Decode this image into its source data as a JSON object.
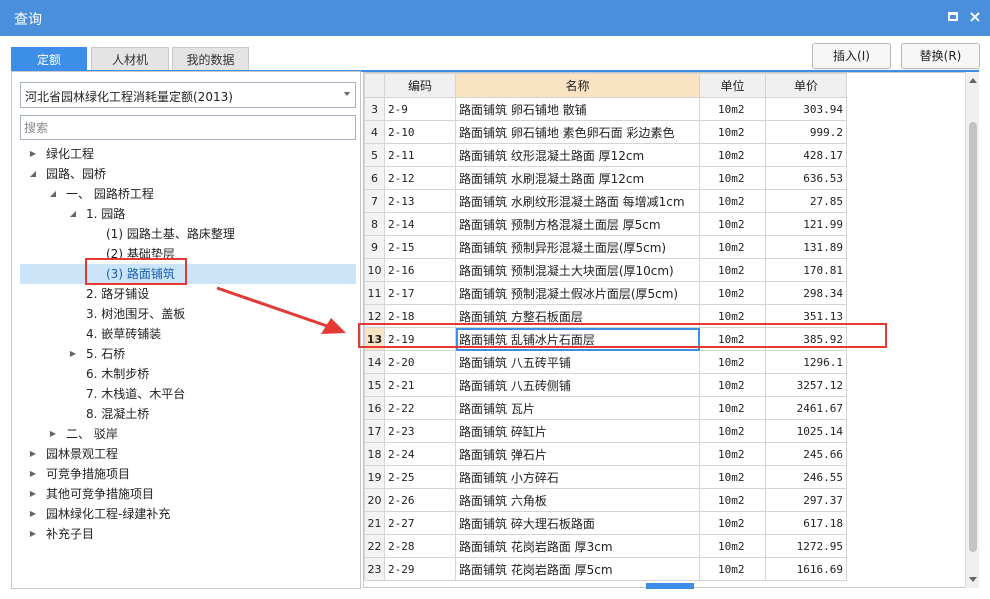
{
  "window": {
    "title": "查询",
    "maximize_icon": "maximize-icon",
    "close_label": "×"
  },
  "tabs": [
    {
      "label": "定额",
      "active": true
    },
    {
      "label": "人材机",
      "active": false
    },
    {
      "label": "我的数据",
      "active": false
    }
  ],
  "toolbar": {
    "insert_label": "插入(I)",
    "replace_label": "替换(R)"
  },
  "left": {
    "library_value": "河北省园林绿化工程消耗量定额(2013)",
    "search_placeholder": "搜索",
    "tree": [
      {
        "label": "绿化工程",
        "level": 0,
        "caret": "right"
      },
      {
        "label": "园路、园桥",
        "level": 0,
        "caret": "down"
      },
      {
        "label": "一、 园路桥工程",
        "level": 1,
        "caret": "down"
      },
      {
        "label": "1. 园路",
        "level": 2,
        "caret": "down"
      },
      {
        "label": "(1) 园路土基、路床整理",
        "level": 3,
        "caret": "none"
      },
      {
        "label": "(2) 基础垫层",
        "level": 3,
        "caret": "none"
      },
      {
        "label": "(3) 路面铺筑",
        "level": 3,
        "caret": "none",
        "selected": true
      },
      {
        "label": "2. 路牙铺设",
        "level": 2,
        "caret": "none"
      },
      {
        "label": "3. 树池围牙、盖板",
        "level": 2,
        "caret": "none"
      },
      {
        "label": "4. 嵌草砖铺装",
        "level": 2,
        "caret": "none"
      },
      {
        "label": "5. 石桥",
        "level": 2,
        "caret": "right"
      },
      {
        "label": "6. 木制步桥",
        "level": 2,
        "caret": "none"
      },
      {
        "label": "7. 木栈道、木平台",
        "level": 2,
        "caret": "none"
      },
      {
        "label": "8. 混凝土桥",
        "level": 2,
        "caret": "none"
      },
      {
        "label": "二、 驳岸",
        "level": 1,
        "caret": "right"
      },
      {
        "label": "园林景观工程",
        "level": 0,
        "caret": "right"
      },
      {
        "label": "可竞争措施项目",
        "level": 0,
        "caret": "right"
      },
      {
        "label": "其他可竞争措施项目",
        "level": 0,
        "caret": "right"
      },
      {
        "label": "园林绿化工程-绿建补充",
        "level": 0,
        "caret": "right"
      },
      {
        "label": "补充子目",
        "level": 0,
        "caret": "right"
      }
    ]
  },
  "grid": {
    "headers": {
      "code": "编码",
      "name": "名称",
      "unit": "单位",
      "price": "单价"
    },
    "current_row": "13",
    "rows": [
      {
        "no": "3",
        "code": "2-9",
        "name": "路面铺筑 卵石铺地 散铺",
        "unit": "10m2",
        "price": "303.94"
      },
      {
        "no": "4",
        "code": "2-10",
        "name": "路面铺筑 卵石铺地 素色卵石面 彩边素色",
        "unit": "10m2",
        "price": "999.2"
      },
      {
        "no": "5",
        "code": "2-11",
        "name": "路面铺筑 纹形混凝土路面 厚12cm",
        "unit": "10m2",
        "price": "428.17"
      },
      {
        "no": "6",
        "code": "2-12",
        "name": "路面铺筑 水刷混凝土路面 厚12cm",
        "unit": "10m2",
        "price": "636.53"
      },
      {
        "no": "7",
        "code": "2-13",
        "name": "路面铺筑 水刷纹形混凝土路面 每增减1cm",
        "unit": "10m2",
        "price": "27.85"
      },
      {
        "no": "8",
        "code": "2-14",
        "name": "路面铺筑 预制方格混凝土面层 厚5cm",
        "unit": "10m2",
        "price": "121.99"
      },
      {
        "no": "9",
        "code": "2-15",
        "name": "路面铺筑 预制异形混凝土面层(厚5cm)",
        "unit": "10m2",
        "price": "131.89"
      },
      {
        "no": "10",
        "code": "2-16",
        "name": "路面铺筑 预制混凝土大块面层(厚10cm)",
        "unit": "10m2",
        "price": "170.81"
      },
      {
        "no": "11",
        "code": "2-17",
        "name": "路面铺筑 预制混凝土假冰片面层(厚5cm)",
        "unit": "10m2",
        "price": "298.34"
      },
      {
        "no": "12",
        "code": "2-18",
        "name": "路面铺筑 方整石板面层",
        "unit": "10m2",
        "price": "351.13"
      },
      {
        "no": "13",
        "code": "2-19",
        "name": "路面铺筑 乱铺冰片石面层",
        "unit": "10m2",
        "price": "385.92"
      },
      {
        "no": "14",
        "code": "2-20",
        "name": "路面铺筑 八五砖平铺",
        "unit": "10m2",
        "price": "1296.1"
      },
      {
        "no": "15",
        "code": "2-21",
        "name": "路面铺筑 八五砖侧铺",
        "unit": "10m2",
        "price": "3257.12"
      },
      {
        "no": "16",
        "code": "2-22",
        "name": "路面铺筑 瓦片",
        "unit": "10m2",
        "price": "2461.67"
      },
      {
        "no": "17",
        "code": "2-23",
        "name": "路面铺筑 碎缸片",
        "unit": "10m2",
        "price": "1025.14"
      },
      {
        "no": "18",
        "code": "2-24",
        "name": "路面铺筑 弹石片",
        "unit": "10m2",
        "price": "245.66"
      },
      {
        "no": "19",
        "code": "2-25",
        "name": "路面铺筑 小方碎石",
        "unit": "10m2",
        "price": "246.55"
      },
      {
        "no": "20",
        "code": "2-26",
        "name": "路面铺筑 六角板",
        "unit": "10m2",
        "price": "297.37"
      },
      {
        "no": "21",
        "code": "2-27",
        "name": "路面铺筑 碎大理石板路面",
        "unit": "10m2",
        "price": "617.18"
      },
      {
        "no": "22",
        "code": "2-28",
        "name": "路面铺筑 花岗岩路面 厚3cm",
        "unit": "10m2",
        "price": "1272.95"
      },
      {
        "no": "23",
        "code": "2-29",
        "name": "路面铺筑 花岗岩路面 厚5cm",
        "unit": "10m2",
        "price": "1616.69"
      }
    ]
  },
  "colors": {
    "accent": "#3c8ee8",
    "titlebar": "#4a8fdc",
    "highlight": "#e53935",
    "selected_bg": "#cce4f7",
    "active_header": "#fae3c3"
  }
}
